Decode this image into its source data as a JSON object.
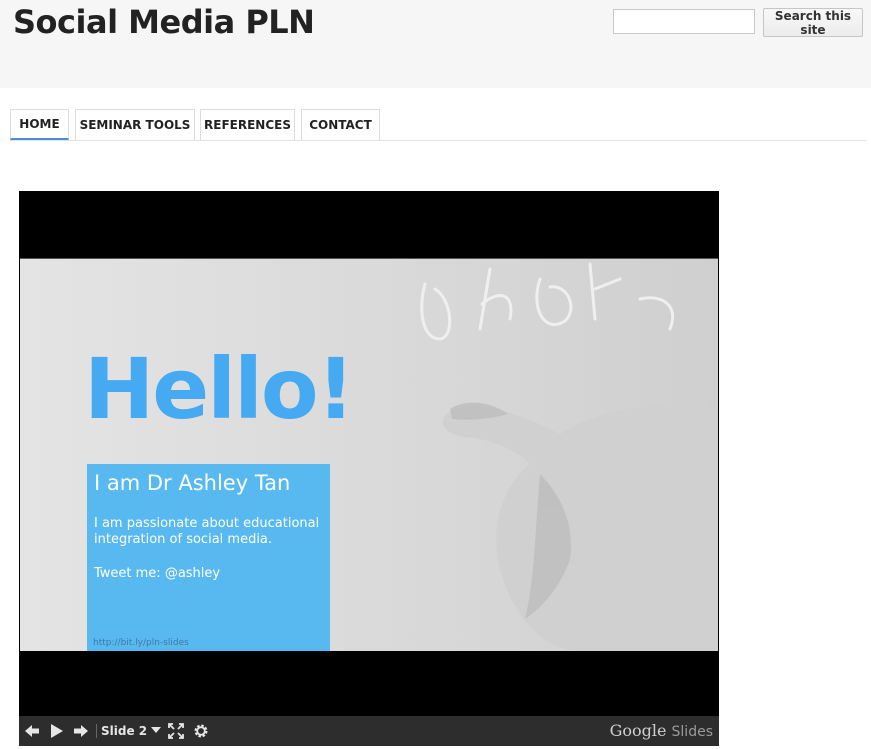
{
  "site": {
    "title": "Social Media PLN"
  },
  "search": {
    "button_label": "Search this site",
    "value": "",
    "placeholder": ""
  },
  "nav": {
    "tabs": [
      {
        "label": "HOME",
        "active": true
      },
      {
        "label": "SEMINAR TOOLS",
        "active": false
      },
      {
        "label": "REFERENCES",
        "active": false
      },
      {
        "label": "CONTACT",
        "active": false
      }
    ]
  },
  "slide": {
    "headline": "Hello!",
    "name": "I am Dr Ashley Tan",
    "description": "I am passionate about educational integration of social media.",
    "tweet": "Tweet me: @ashley",
    "url": "http://bit.ly/pln-slides"
  },
  "player": {
    "current_slide": "Slide 2",
    "brand_primary": "Google",
    "brand_secondary": "Slides",
    "icons": [
      "arrow-left-icon",
      "play-icon",
      "arrow-right-icon",
      "chevron-down-icon",
      "fullscreen-icon",
      "gear-icon"
    ]
  },
  "colors": {
    "accent_tab": "#4a8ed6",
    "slide_blue": "#45aaf2",
    "box_blue": "#58b9f1",
    "player_bar": "#2d2d2d"
  }
}
